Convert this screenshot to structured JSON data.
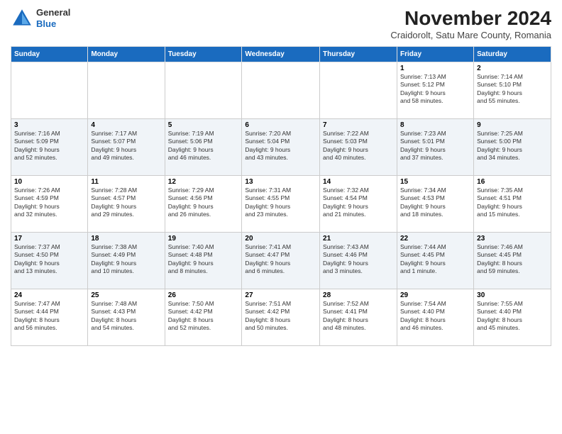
{
  "header": {
    "logo_general": "General",
    "logo_blue": "Blue",
    "month_title": "November 2024",
    "location": "Craidorolt, Satu Mare County, Romania"
  },
  "days_of_week": [
    "Sunday",
    "Monday",
    "Tuesday",
    "Wednesday",
    "Thursday",
    "Friday",
    "Saturday"
  ],
  "weeks": [
    [
      {
        "day": "",
        "info": ""
      },
      {
        "day": "",
        "info": ""
      },
      {
        "day": "",
        "info": ""
      },
      {
        "day": "",
        "info": ""
      },
      {
        "day": "",
        "info": ""
      },
      {
        "day": "1",
        "info": "Sunrise: 7:13 AM\nSunset: 5:12 PM\nDaylight: 9 hours\nand 58 minutes."
      },
      {
        "day": "2",
        "info": "Sunrise: 7:14 AM\nSunset: 5:10 PM\nDaylight: 9 hours\nand 55 minutes."
      }
    ],
    [
      {
        "day": "3",
        "info": "Sunrise: 7:16 AM\nSunset: 5:09 PM\nDaylight: 9 hours\nand 52 minutes."
      },
      {
        "day": "4",
        "info": "Sunrise: 7:17 AM\nSunset: 5:07 PM\nDaylight: 9 hours\nand 49 minutes."
      },
      {
        "day": "5",
        "info": "Sunrise: 7:19 AM\nSunset: 5:06 PM\nDaylight: 9 hours\nand 46 minutes."
      },
      {
        "day": "6",
        "info": "Sunrise: 7:20 AM\nSunset: 5:04 PM\nDaylight: 9 hours\nand 43 minutes."
      },
      {
        "day": "7",
        "info": "Sunrise: 7:22 AM\nSunset: 5:03 PM\nDaylight: 9 hours\nand 40 minutes."
      },
      {
        "day": "8",
        "info": "Sunrise: 7:23 AM\nSunset: 5:01 PM\nDaylight: 9 hours\nand 37 minutes."
      },
      {
        "day": "9",
        "info": "Sunrise: 7:25 AM\nSunset: 5:00 PM\nDaylight: 9 hours\nand 34 minutes."
      }
    ],
    [
      {
        "day": "10",
        "info": "Sunrise: 7:26 AM\nSunset: 4:59 PM\nDaylight: 9 hours\nand 32 minutes."
      },
      {
        "day": "11",
        "info": "Sunrise: 7:28 AM\nSunset: 4:57 PM\nDaylight: 9 hours\nand 29 minutes."
      },
      {
        "day": "12",
        "info": "Sunrise: 7:29 AM\nSunset: 4:56 PM\nDaylight: 9 hours\nand 26 minutes."
      },
      {
        "day": "13",
        "info": "Sunrise: 7:31 AM\nSunset: 4:55 PM\nDaylight: 9 hours\nand 23 minutes."
      },
      {
        "day": "14",
        "info": "Sunrise: 7:32 AM\nSunset: 4:54 PM\nDaylight: 9 hours\nand 21 minutes."
      },
      {
        "day": "15",
        "info": "Sunrise: 7:34 AM\nSunset: 4:53 PM\nDaylight: 9 hours\nand 18 minutes."
      },
      {
        "day": "16",
        "info": "Sunrise: 7:35 AM\nSunset: 4:51 PM\nDaylight: 9 hours\nand 15 minutes."
      }
    ],
    [
      {
        "day": "17",
        "info": "Sunrise: 7:37 AM\nSunset: 4:50 PM\nDaylight: 9 hours\nand 13 minutes."
      },
      {
        "day": "18",
        "info": "Sunrise: 7:38 AM\nSunset: 4:49 PM\nDaylight: 9 hours\nand 10 minutes."
      },
      {
        "day": "19",
        "info": "Sunrise: 7:40 AM\nSunset: 4:48 PM\nDaylight: 9 hours\nand 8 minutes."
      },
      {
        "day": "20",
        "info": "Sunrise: 7:41 AM\nSunset: 4:47 PM\nDaylight: 9 hours\nand 6 minutes."
      },
      {
        "day": "21",
        "info": "Sunrise: 7:43 AM\nSunset: 4:46 PM\nDaylight: 9 hours\nand 3 minutes."
      },
      {
        "day": "22",
        "info": "Sunrise: 7:44 AM\nSunset: 4:45 PM\nDaylight: 9 hours\nand 1 minute."
      },
      {
        "day": "23",
        "info": "Sunrise: 7:46 AM\nSunset: 4:45 PM\nDaylight: 8 hours\nand 59 minutes."
      }
    ],
    [
      {
        "day": "24",
        "info": "Sunrise: 7:47 AM\nSunset: 4:44 PM\nDaylight: 8 hours\nand 56 minutes."
      },
      {
        "day": "25",
        "info": "Sunrise: 7:48 AM\nSunset: 4:43 PM\nDaylight: 8 hours\nand 54 minutes."
      },
      {
        "day": "26",
        "info": "Sunrise: 7:50 AM\nSunset: 4:42 PM\nDaylight: 8 hours\nand 52 minutes."
      },
      {
        "day": "27",
        "info": "Sunrise: 7:51 AM\nSunset: 4:42 PM\nDaylight: 8 hours\nand 50 minutes."
      },
      {
        "day": "28",
        "info": "Sunrise: 7:52 AM\nSunset: 4:41 PM\nDaylight: 8 hours\nand 48 minutes."
      },
      {
        "day": "29",
        "info": "Sunrise: 7:54 AM\nSunset: 4:40 PM\nDaylight: 8 hours\nand 46 minutes."
      },
      {
        "day": "30",
        "info": "Sunrise: 7:55 AM\nSunset: 4:40 PM\nDaylight: 8 hours\nand 45 minutes."
      }
    ]
  ]
}
